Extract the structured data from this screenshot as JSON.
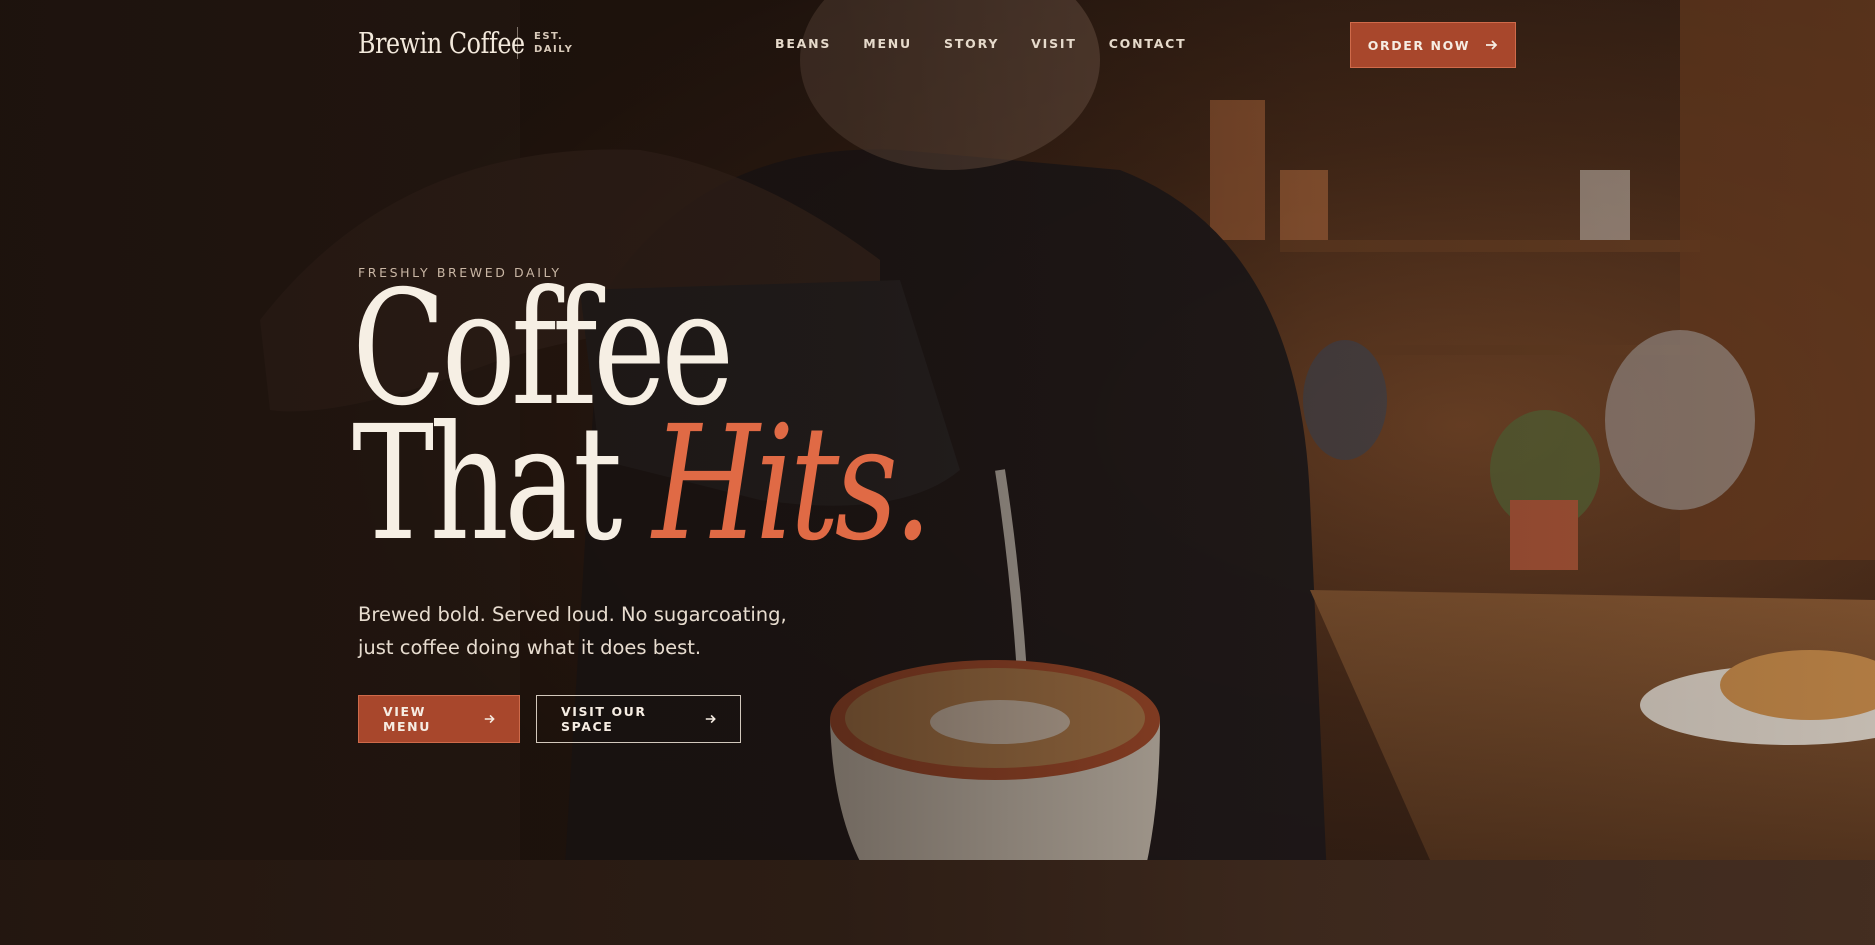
{
  "header": {
    "brand": "Brewin Coffee",
    "est_line1": "EST.",
    "est_line2": "DAILY",
    "nav": [
      "BEANS",
      "MENU",
      "STORY",
      "VISIT",
      "CONTACT"
    ],
    "cta": "ORDER NOW"
  },
  "hero": {
    "kicker": "FRESHLY BREWED DAILY",
    "headline_line1": "Coffee",
    "headline_line2_a": "That ",
    "headline_line2_b": "Hits.",
    "subtitle": "Brewed bold. Served loud. No sugarcoating, just coffee doing what it does best.",
    "primary_button": "VIEW MENU",
    "secondary_button": "VISIT OUR SPACE"
  },
  "colors": {
    "accent": "#a8472c",
    "accent_text": "#e06a45",
    "cream": "#f6efe4"
  },
  "icons": {
    "arrow": "arrow-right-icon",
    "background": "barista-pour-photo"
  }
}
